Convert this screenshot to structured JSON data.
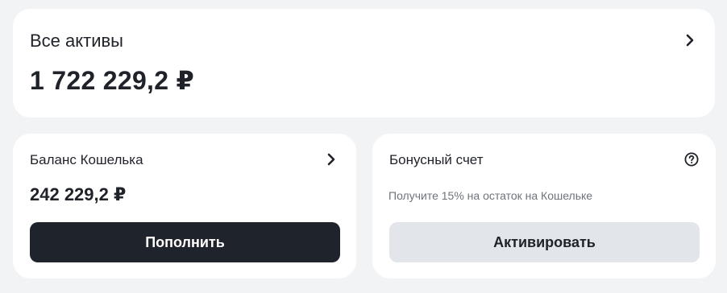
{
  "total_assets": {
    "title": "Все активы",
    "amount": "1 722 229,2 ₽",
    "chevron_icon": "chevron-right"
  },
  "wallet": {
    "title": "Баланс Кошелька",
    "amount": "242 229,2 ₽",
    "chevron_icon": "chevron-right",
    "button_label": "Пополнить"
  },
  "bonus": {
    "title": "Бонусный счет",
    "hint": "Получите 15% на остаток на Кошельке",
    "help_icon": "question-circle",
    "button_label": "Активировать"
  },
  "colors": {
    "background": "#f2f3f5",
    "card": "#ffffff",
    "primary_button": "#1f232b",
    "secondary_button": "#e2e5ea",
    "text": "#1f2229",
    "muted_text": "#6f737c"
  }
}
